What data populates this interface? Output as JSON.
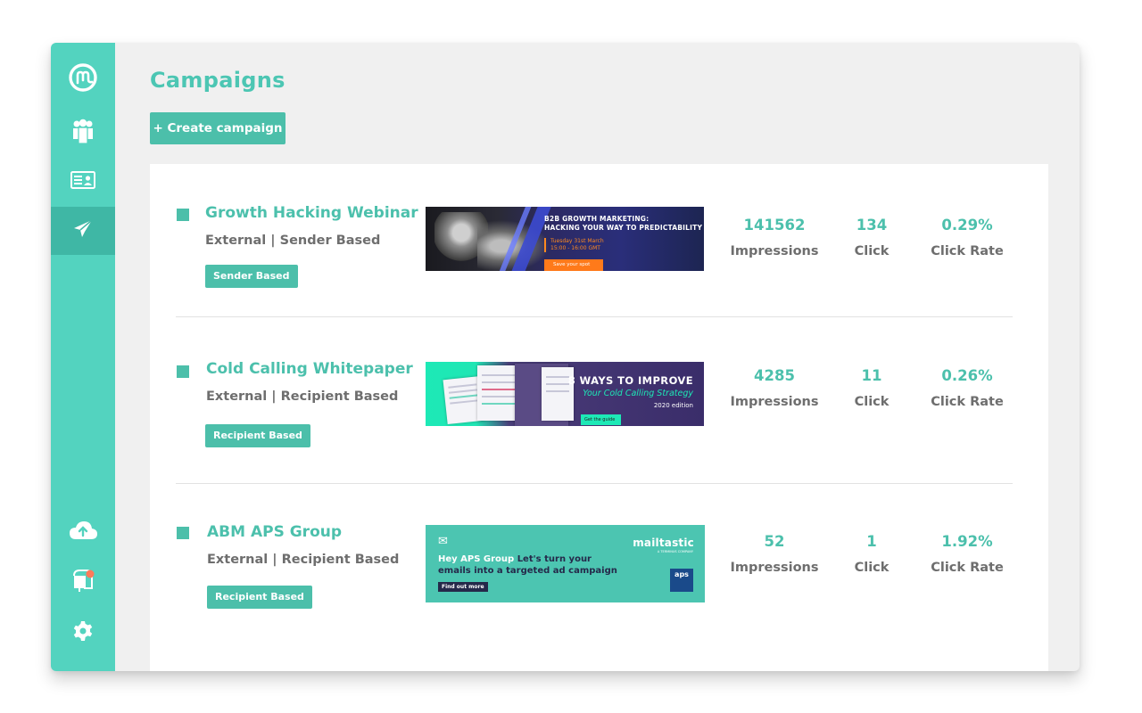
{
  "page": {
    "title": "Campaigns",
    "create_button_label": "+ Create campaign"
  },
  "sidebar": {
    "items": [
      {
        "name": "logo",
        "icon": "mailtastic-logo-icon",
        "active": false
      },
      {
        "name": "employees",
        "icon": "users-icon",
        "active": false
      },
      {
        "name": "signatures",
        "icon": "id-card-icon",
        "active": false
      },
      {
        "name": "campaigns",
        "icon": "paper-plane-icon",
        "active": true
      }
    ],
    "bottom_items": [
      {
        "name": "upload",
        "icon": "cloud-upload-icon"
      },
      {
        "name": "mailbox",
        "icon": "mailbox-icon"
      },
      {
        "name": "settings",
        "icon": "gear-icon"
      }
    ],
    "accent_color": "#53d3bf"
  },
  "campaigns": [
    {
      "title": "Growth Hacking Webinar",
      "subtitle": "External | Sender Based",
      "tag": "Sender Based",
      "banner": {
        "headline": "B2B GROWTH MARKETING:",
        "headline2": "HACKING YOUR WAY TO PREDICTABILITY",
        "date": "Tuesday 31st March",
        "time": "15:00 - 16:00 GMT",
        "cta": "Save your spot"
      },
      "stats": {
        "impressions": "141562",
        "clicks": "134",
        "click_rate": "0.29%"
      }
    },
    {
      "title": "Cold Calling Whitepaper",
      "subtitle": "External | Recipient Based",
      "tag": "Recipient Based",
      "banner": {
        "headline": "8 WAYS TO IMPROVE",
        "headline2": "Your Cold Calling Strategy",
        "edition": "2020 edition",
        "cta": "Get the guide"
      },
      "stats": {
        "impressions": "4285",
        "clicks": "11",
        "click_rate": "0.26%"
      }
    },
    {
      "title": "ABM APS Group",
      "subtitle": "External | Recipient Based",
      "tag": "Recipient Based",
      "banner": {
        "highlight": "Hey APS Group",
        "message": "Let's turn your",
        "message2": "emails into a targeted ad campaign",
        "cta": "Find out more",
        "brand": "mailtastic",
        "brand_sub": "A TERMINUS COMPANY",
        "partner": "aps"
      },
      "stats": {
        "impressions": "52",
        "clicks": "1",
        "click_rate": "1.92%"
      }
    }
  ],
  "stat_labels": {
    "impressions": "Impressions",
    "clicks": "Click",
    "click_rate": "Click Rate"
  }
}
